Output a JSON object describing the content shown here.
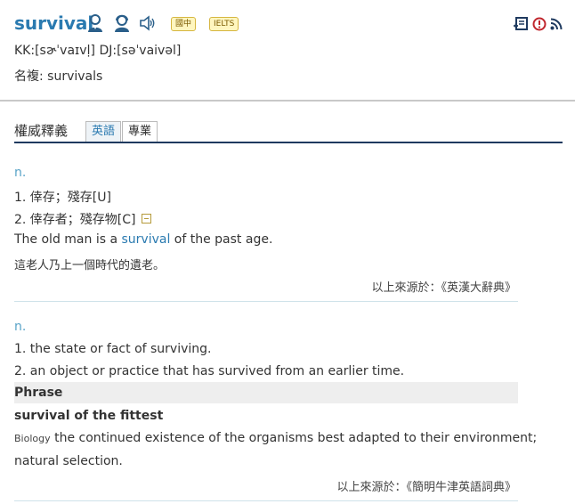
{
  "header": {
    "word": "survival",
    "badges": [
      "國中",
      "IELTS"
    ],
    "pronunciation": "KK:[sɚˈvaɪvḷ] DJ:[səˈvaivəl]",
    "inflection": "名複: survivals"
  },
  "tabs": {
    "title": "權威釋義",
    "items": [
      "英語",
      "專業"
    ],
    "active": "英語"
  },
  "section1": {
    "pos": "n.",
    "defs": [
      "1. 倖存；殘存[U]",
      "2. 倖存者；殘存物[C]"
    ],
    "example_before": "The old man is a ",
    "example_highlight": "survival",
    "example_after": " of the past age.",
    "translation": "這老人乃上一個時代的遺老。",
    "source": "以上來源於：《英漢大辭典》"
  },
  "section2": {
    "pos": "n.",
    "defs": [
      "1. the state or fact of surviving.",
      "2. an object or practice that has survived from an earlier time."
    ],
    "phrase_header": "Phrase",
    "phrase": "survival of the fittest",
    "domain_label": "Biology",
    "phrase_def_1": " the continued existence of the organisms best adapted to their environment;",
    "phrase_def_2": "natural selection.",
    "source": "以上來源於：《簡明牛津英語詞典》"
  },
  "colors": {
    "accent": "#2a7ab0",
    "pos": "#5aa4c8",
    "navy": "#1f3a5f",
    "badge_bg": "#fff6bf"
  }
}
